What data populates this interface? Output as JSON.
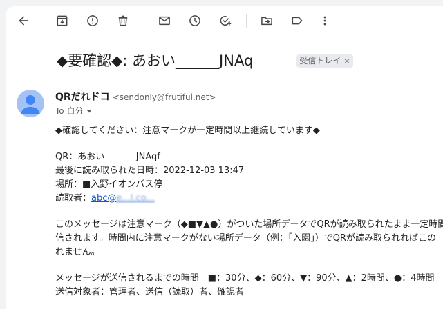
{
  "toolbar": {
    "buttons": [
      {
        "name": "back-icon"
      },
      {
        "name": "archive-icon"
      },
      {
        "name": "report-spam-icon"
      },
      {
        "name": "delete-icon"
      },
      {
        "name": "mark-unread-icon"
      },
      {
        "name": "snooze-icon"
      },
      {
        "name": "add-task-icon"
      },
      {
        "name": "move-to-icon"
      },
      {
        "name": "label-icon"
      },
      {
        "name": "more-vert-icon"
      }
    ]
  },
  "email": {
    "subject": "◆要確認◆: あおい______JNAq",
    "label": "受信トレイ",
    "label_close": "×",
    "sender_name": "QRだれドコ",
    "sender_email": "<sendonly@frutiful.net>",
    "to": "To 自分",
    "body": {
      "line1": "◆確認してください：注意マークが一定時間以上継続しています◆",
      "qr": "QR：あおい_______JNAqf",
      "last_read": "最後に読み取られた日時：2022-12-03 13:47",
      "place": "場所：■入野イオンバス停",
      "reader_prefix": "読取者：",
      "reader_link": "abc@",
      "reader_link_blurred": "e...l.co...",
      "para1": "このメッセージは注意マーク（◆■▼▲●）がついた場所データでQRが読み取られたまま一定時間",
      "para2": "信されます。時間内に注意マークがない場所データ（例：「入園」）でQRが読み取られればこの",
      "para3": "れません。",
      "times": "メッセージが送信されるまでの時間　■：30分、◆：60分、▼：90分、▲：2時間、●：4時間",
      "recipients": "送信対象者：管理者、送信（読取）者、確認者"
    }
  },
  "colors": {
    "accent_link": "#1155cc",
    "avatar_bg": "#a4c2f4",
    "avatar_fg": "#4285f4",
    "chip_bg": "#e8eaed"
  }
}
